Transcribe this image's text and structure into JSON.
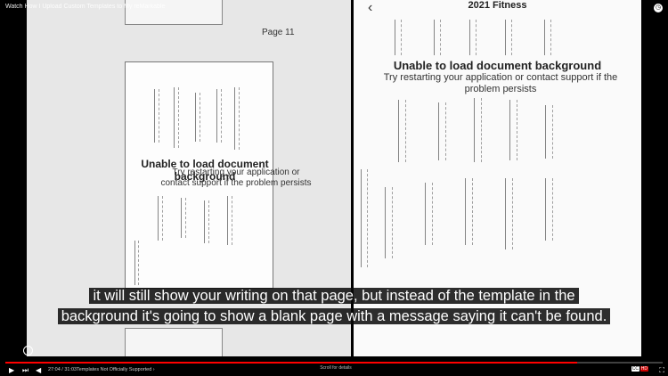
{
  "video": {
    "title": "Watch How I Upload Custom Templates to My reMarkable",
    "time": "27:04 / 31:03",
    "chapter": "Templates Not Officially Supported ›",
    "progress": 0.87,
    "scroll_hint": "Scroll for details",
    "cc_label": "CC",
    "hd_label": "HD",
    "accent": "#ff0000"
  },
  "left_panel": {
    "page_label": "Page 11",
    "error_title": "Unable to load document background",
    "error_body": "Try restarting your application or contact support if the problem persists"
  },
  "right_panel": {
    "document_title": "2021 Fitness",
    "error_title": "Unable to load document background",
    "error_body": "Try restarting your application or contact support if the problem persists"
  },
  "caption": {
    "line1": "it will still show your writing on that page, but instead of the template in the",
    "line2": "background it's going to show a blank page with a message saying it can't be found."
  },
  "icons": {
    "back": "arrow-left-icon",
    "play": "play-icon",
    "next": "skip-next-icon",
    "volume": "volume-icon",
    "settings": "gear-icon",
    "fullscreen": "fullscreen-icon"
  }
}
